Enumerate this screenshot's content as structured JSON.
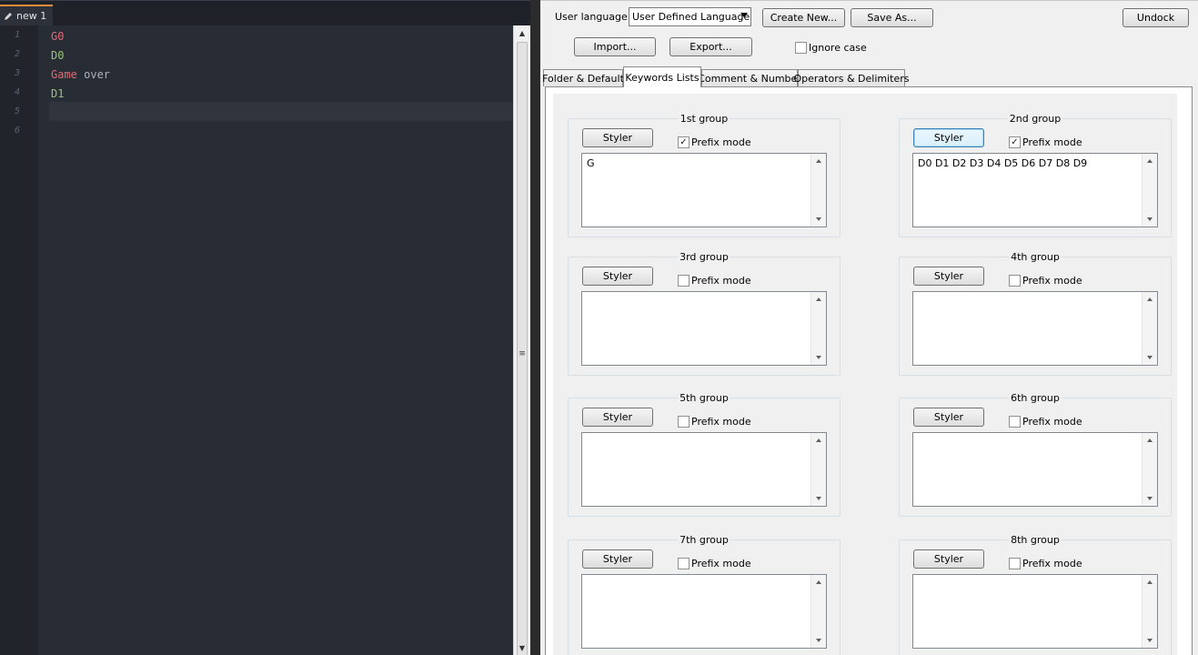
{
  "editor": {
    "tab_label": "new 1",
    "line_numbers": [
      "1",
      "2",
      "3",
      "4",
      "5",
      "6"
    ],
    "lines": [
      [
        {
          "text": "G0",
          "style": "kw1"
        }
      ],
      [
        {
          "text": "D0",
          "style": "kw2"
        }
      ],
      [
        {
          "text": "Game",
          "style": "kw1"
        },
        {
          "text": " over",
          "style": "plain"
        }
      ],
      [
        {
          "text": "D1",
          "style": "kw2"
        }
      ],
      [],
      []
    ],
    "colors": {
      "background": "#282c34",
      "keyword_group1": "#e06c75",
      "keyword_group2": "#98c379",
      "plain_text": "#abb2bf"
    }
  },
  "udl": {
    "user_language_label": "User language :",
    "user_language_value": "User Defined Language",
    "create_new": "Create New...",
    "save_as": "Save As...",
    "undock": "Undock",
    "import": "Import...",
    "export": "Export...",
    "ignore_case": "Ignore case",
    "tabs": [
      "Folder & Default",
      "Keywords Lists",
      "Comment & Number",
      "Operators & Delimiters"
    ],
    "active_tab": "Keywords Lists",
    "styler_label": "Styler",
    "prefix_label": "Prefix mode",
    "groups": [
      {
        "title": "1st group",
        "prefix": true,
        "keywords": "G"
      },
      {
        "title": "2nd group",
        "prefix": true,
        "keywords": "D0 D1 D2 D3 D4 D5 D6 D7 D8 D9"
      },
      {
        "title": "3rd group",
        "prefix": false,
        "keywords": ""
      },
      {
        "title": "4th group",
        "prefix": false,
        "keywords": ""
      },
      {
        "title": "5th group",
        "prefix": false,
        "keywords": ""
      },
      {
        "title": "6th group",
        "prefix": false,
        "keywords": ""
      },
      {
        "title": "7th group",
        "prefix": false,
        "keywords": ""
      },
      {
        "title": "8th group",
        "prefix": false,
        "keywords": ""
      }
    ]
  }
}
